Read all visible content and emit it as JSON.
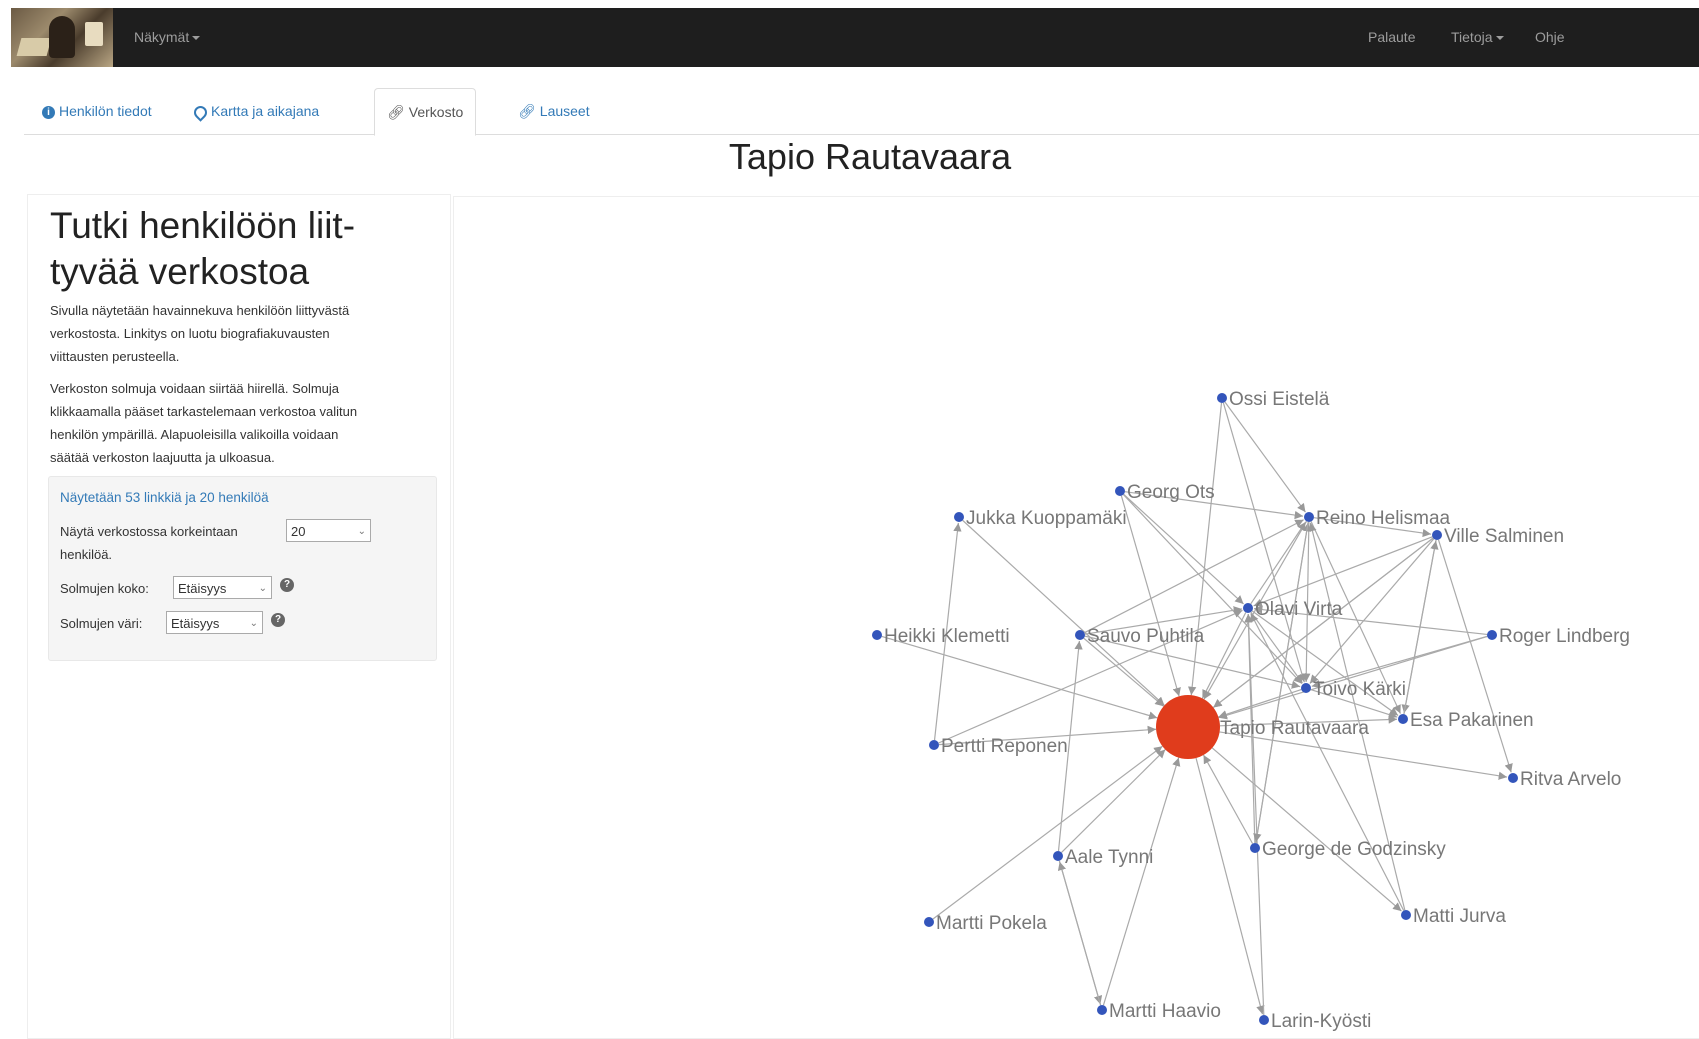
{
  "navbar": {
    "views_label": "Näkymät",
    "feedback_label": "Palaute",
    "info_label": "Tietoja",
    "help_label": "Ohje"
  },
  "tabs": [
    {
      "label": "Henkilön tiedot",
      "icon": "info-circle-icon"
    },
    {
      "label": "Kartta ja aikajana",
      "icon": "map-marker-icon"
    },
    {
      "label": "Verkosto",
      "icon": "link-icon"
    },
    {
      "label": "Lauseet",
      "icon": "link-icon"
    }
  ],
  "active_tab": "Verkosto",
  "page_title": "Tapio Rautavaara",
  "sidebar": {
    "heading_line1": "Tutki henkilöön liit-",
    "heading_line2": "tyvää verkostoa",
    "para1_line1": "Sivulla näytetään havainnekuva henkilöön liittyvästä",
    "para1_line2": "verkostosta. Linkitys on luotu biografiakuvausten",
    "para1_line3": "viittausten perusteella.",
    "para2_line1": "Verkoston solmuja voidaan siirtää hiirellä. Solmuja",
    "para2_line2": "klikkaamalla pääset tarkastelemaan verkostoa valitun",
    "para2_line3": "henkilön ympärillä. Alapuoleisilla valikoilla voidaan",
    "para2_line4": "säätää verkoston laajuutta ja ulkoasua.",
    "summary_link": "Näytetään 53 linkkiä ja 20 henkilöä",
    "limit_label": "Näytä verkostossa korkeintaan",
    "limit_value": "20",
    "limit_suffix": "henkilöä.",
    "size_label": "Solmujen koko:",
    "size_value": "Etäisyys",
    "color_label": "Solmujen väri:",
    "color_value": "Etäisyys"
  },
  "network": {
    "node_color": "#3355bb",
    "center_color": "#e03c1c",
    "edge_color": "#aaaaaa",
    "nodes": [
      {
        "id": "tapio",
        "label": "Tapio Rautavaara",
        "center": true
      },
      {
        "id": "ossi",
        "label": "Ossi Eistelä"
      },
      {
        "id": "georg",
        "label": "Georg Ots"
      },
      {
        "id": "jukka",
        "label": "Jukka Kuoppamäki"
      },
      {
        "id": "reino",
        "label": "Reino Helismaa"
      },
      {
        "id": "ville",
        "label": "Ville Salminen"
      },
      {
        "id": "olavi",
        "label": "Olavi Virta"
      },
      {
        "id": "heikki",
        "label": "Heikki Klemetti"
      },
      {
        "id": "sauvo",
        "label": "Sauvo Puhtila"
      },
      {
        "id": "roger",
        "label": "Roger Lindberg"
      },
      {
        "id": "toivo",
        "label": "Toivo Kärki"
      },
      {
        "id": "esa",
        "label": "Esa Pakarinen"
      },
      {
        "id": "pertti",
        "label": "Pertti Reponen"
      },
      {
        "id": "ritva",
        "label": "Ritva Arvelo"
      },
      {
        "id": "george",
        "label": "George de Godzinsky"
      },
      {
        "id": "aale",
        "label": "Aale Tynni"
      },
      {
        "id": "matti",
        "label": "Matti Jurva"
      },
      {
        "id": "marttip",
        "label": "Martti Pokela"
      },
      {
        "id": "marttih",
        "label": "Martti Haavio"
      },
      {
        "id": "larin",
        "label": "Larin-Kyösti"
      }
    ],
    "edges": [
      [
        "ossi",
        "tapio"
      ],
      [
        "georg",
        "tapio"
      ],
      [
        "jukka",
        "tapio"
      ],
      [
        "reino",
        "tapio"
      ],
      [
        "ville",
        "tapio"
      ],
      [
        "olavi",
        "tapio"
      ],
      [
        "heikki",
        "tapio"
      ],
      [
        "sauvo",
        "tapio"
      ],
      [
        "roger",
        "tapio"
      ],
      [
        "toivo",
        "tapio"
      ],
      [
        "tapio",
        "esa"
      ],
      [
        "pertti",
        "tapio"
      ],
      [
        "tapio",
        "ritva"
      ],
      [
        "george",
        "tapio"
      ],
      [
        "aale",
        "tapio"
      ],
      [
        "tapio",
        "matti"
      ],
      [
        "marttip",
        "tapio"
      ],
      [
        "marttih",
        "tapio"
      ],
      [
        "tapio",
        "larin"
      ],
      [
        "ossi",
        "reino"
      ],
      [
        "georg",
        "reino"
      ],
      [
        "ossi",
        "toivo"
      ],
      [
        "georg",
        "toivo"
      ],
      [
        "georg",
        "olavi"
      ],
      [
        "sauvo",
        "reino"
      ],
      [
        "sauvo",
        "toivo"
      ],
      [
        "olavi",
        "reino"
      ],
      [
        "olavi",
        "toivo"
      ],
      [
        "olavi",
        "esa"
      ],
      [
        "reino",
        "toivo"
      ],
      [
        "reino",
        "esa"
      ],
      [
        "reino",
        "ville"
      ],
      [
        "ville",
        "olavi"
      ],
      [
        "ville",
        "toivo"
      ],
      [
        "ville",
        "esa"
      ],
      [
        "ville",
        "ritva"
      ],
      [
        "ville",
        "tapio"
      ],
      [
        "roger",
        "toivo"
      ],
      [
        "roger",
        "olavi"
      ],
      [
        "toivo",
        "esa"
      ],
      [
        "george",
        "olavi"
      ],
      [
        "george",
        "reino"
      ],
      [
        "matti",
        "olavi"
      ],
      [
        "matti",
        "reino"
      ],
      [
        "pertti",
        "jukka"
      ],
      [
        "pertti",
        "olavi"
      ],
      [
        "aale",
        "sauvo"
      ],
      [
        "aale",
        "marttih"
      ],
      [
        "marttih",
        "aale"
      ],
      [
        "larin",
        "olavi"
      ],
      [
        "reino",
        "george"
      ],
      [
        "sauvo",
        "olavi"
      ],
      [
        "esa",
        "ville"
      ]
    ]
  }
}
